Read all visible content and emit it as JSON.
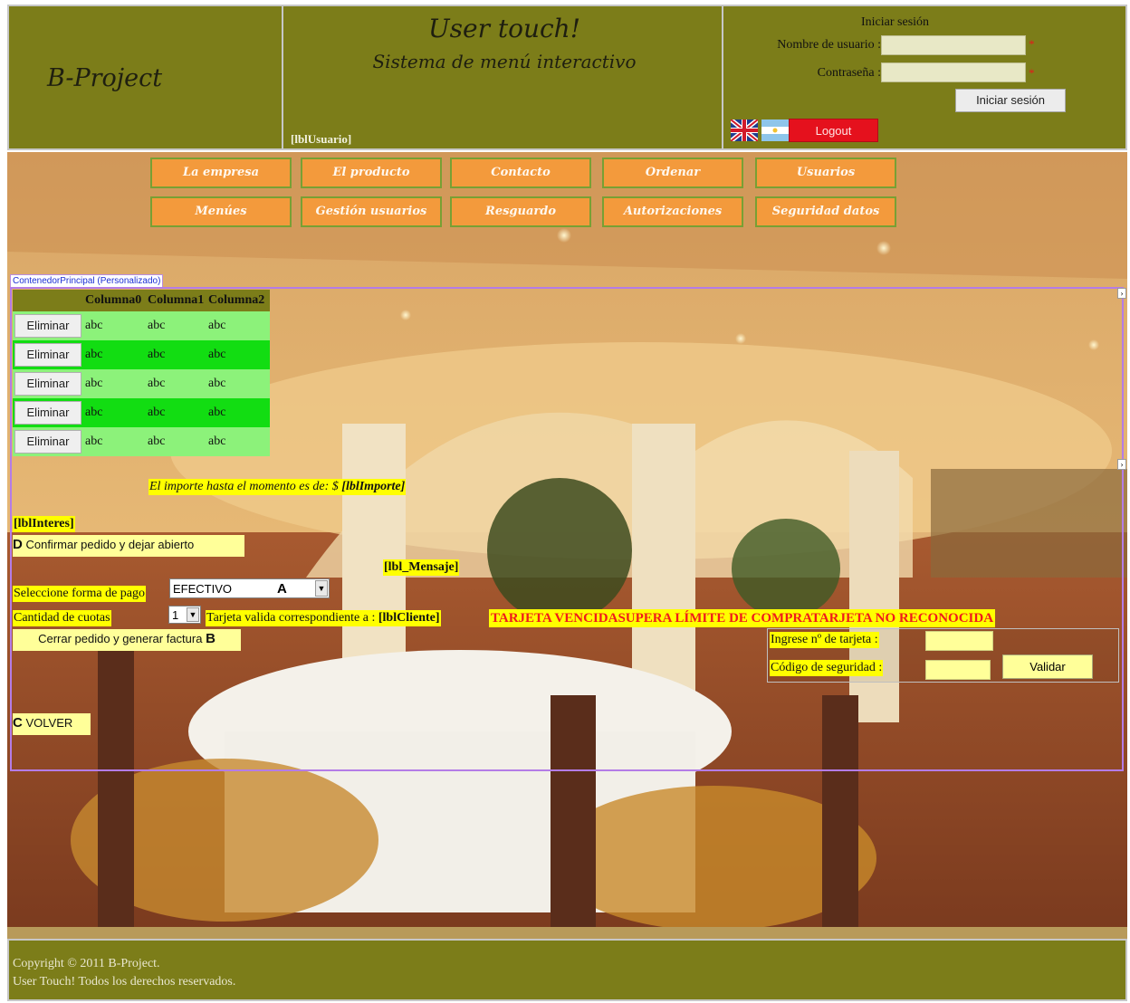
{
  "header": {
    "logo": "B-Project",
    "title": "User touch!",
    "subtitle": "Sistema de menú interactivo",
    "user_label": "[lblUsuario]",
    "login": {
      "heading": "Iniciar sesión",
      "username_label": "Nombre de usuario :",
      "password_label": "Contraseña :",
      "required_mark": "*",
      "submit_label": "Iniciar sesión",
      "logout_label": "Logout"
    },
    "languages": [
      "english-flag-icon",
      "argentina-flag-icon"
    ]
  },
  "menu": {
    "row1": [
      "La empresa",
      "El producto",
      "Contacto",
      "Ordenar",
      "Usuarios"
    ],
    "row2": [
      "Menúes",
      "Gestión usuarios",
      "Resguardo",
      "Autorizaciones",
      "Seguridad datos"
    ]
  },
  "container_label": "ContenedorPrincipal (Personalizado)",
  "grid": {
    "columns": [
      "Columna0",
      "Columna1",
      "Columna2"
    ],
    "delete_label": "Eliminar",
    "rows": [
      [
        "abc",
        "abc",
        "abc"
      ],
      [
        "abc",
        "abc",
        "abc"
      ],
      [
        "abc",
        "abc",
        "abc"
      ],
      [
        "abc",
        "abc",
        "abc"
      ],
      [
        "abc",
        "abc",
        "abc"
      ]
    ]
  },
  "order": {
    "importe_text": "El importe hasta el momento es de: $",
    "importe_label": "[lblImporte]",
    "interes_label": "[lblInteres]",
    "confirm_key": "D",
    "confirm_label": "Confirmar pedido y dejar abierto",
    "mensaje_label": "[lbl_Mensaje]",
    "payment_label": "Seleccione forma de pago",
    "payment_selected": "EFECTIVO",
    "payment_key": "A",
    "installments_label": "Cantidad de cuotas",
    "installments_selected": "1",
    "card_valid_label": "Tarjeta valida correspondiente a :",
    "cliente_label": "[lblCliente]",
    "close_label": "Cerrar pedido y generar factura",
    "close_key": "B",
    "back_key": "C",
    "back_label": "VOLVER",
    "error_text": "TARJETA VENCIDASUPERA LÍMITE DE COMPRATARJETA NO RECONOCIDA"
  },
  "card": {
    "number_label": "Ingrese nº de tarjeta :",
    "security_label": "Código de seguridad :",
    "validate_label": "Validar"
  },
  "footer": {
    "line1": "Copyright © 2011 B-Project.",
    "line2": "User Touch! Todos los derechos reservados."
  },
  "colors": {
    "header_bg": "#7c7d19",
    "menu_bg": "#f39a3c",
    "highlight": "#ffff00",
    "error": "#f01b1b",
    "grid_light": "#8cf27a",
    "grid_dark": "#12dd12"
  }
}
